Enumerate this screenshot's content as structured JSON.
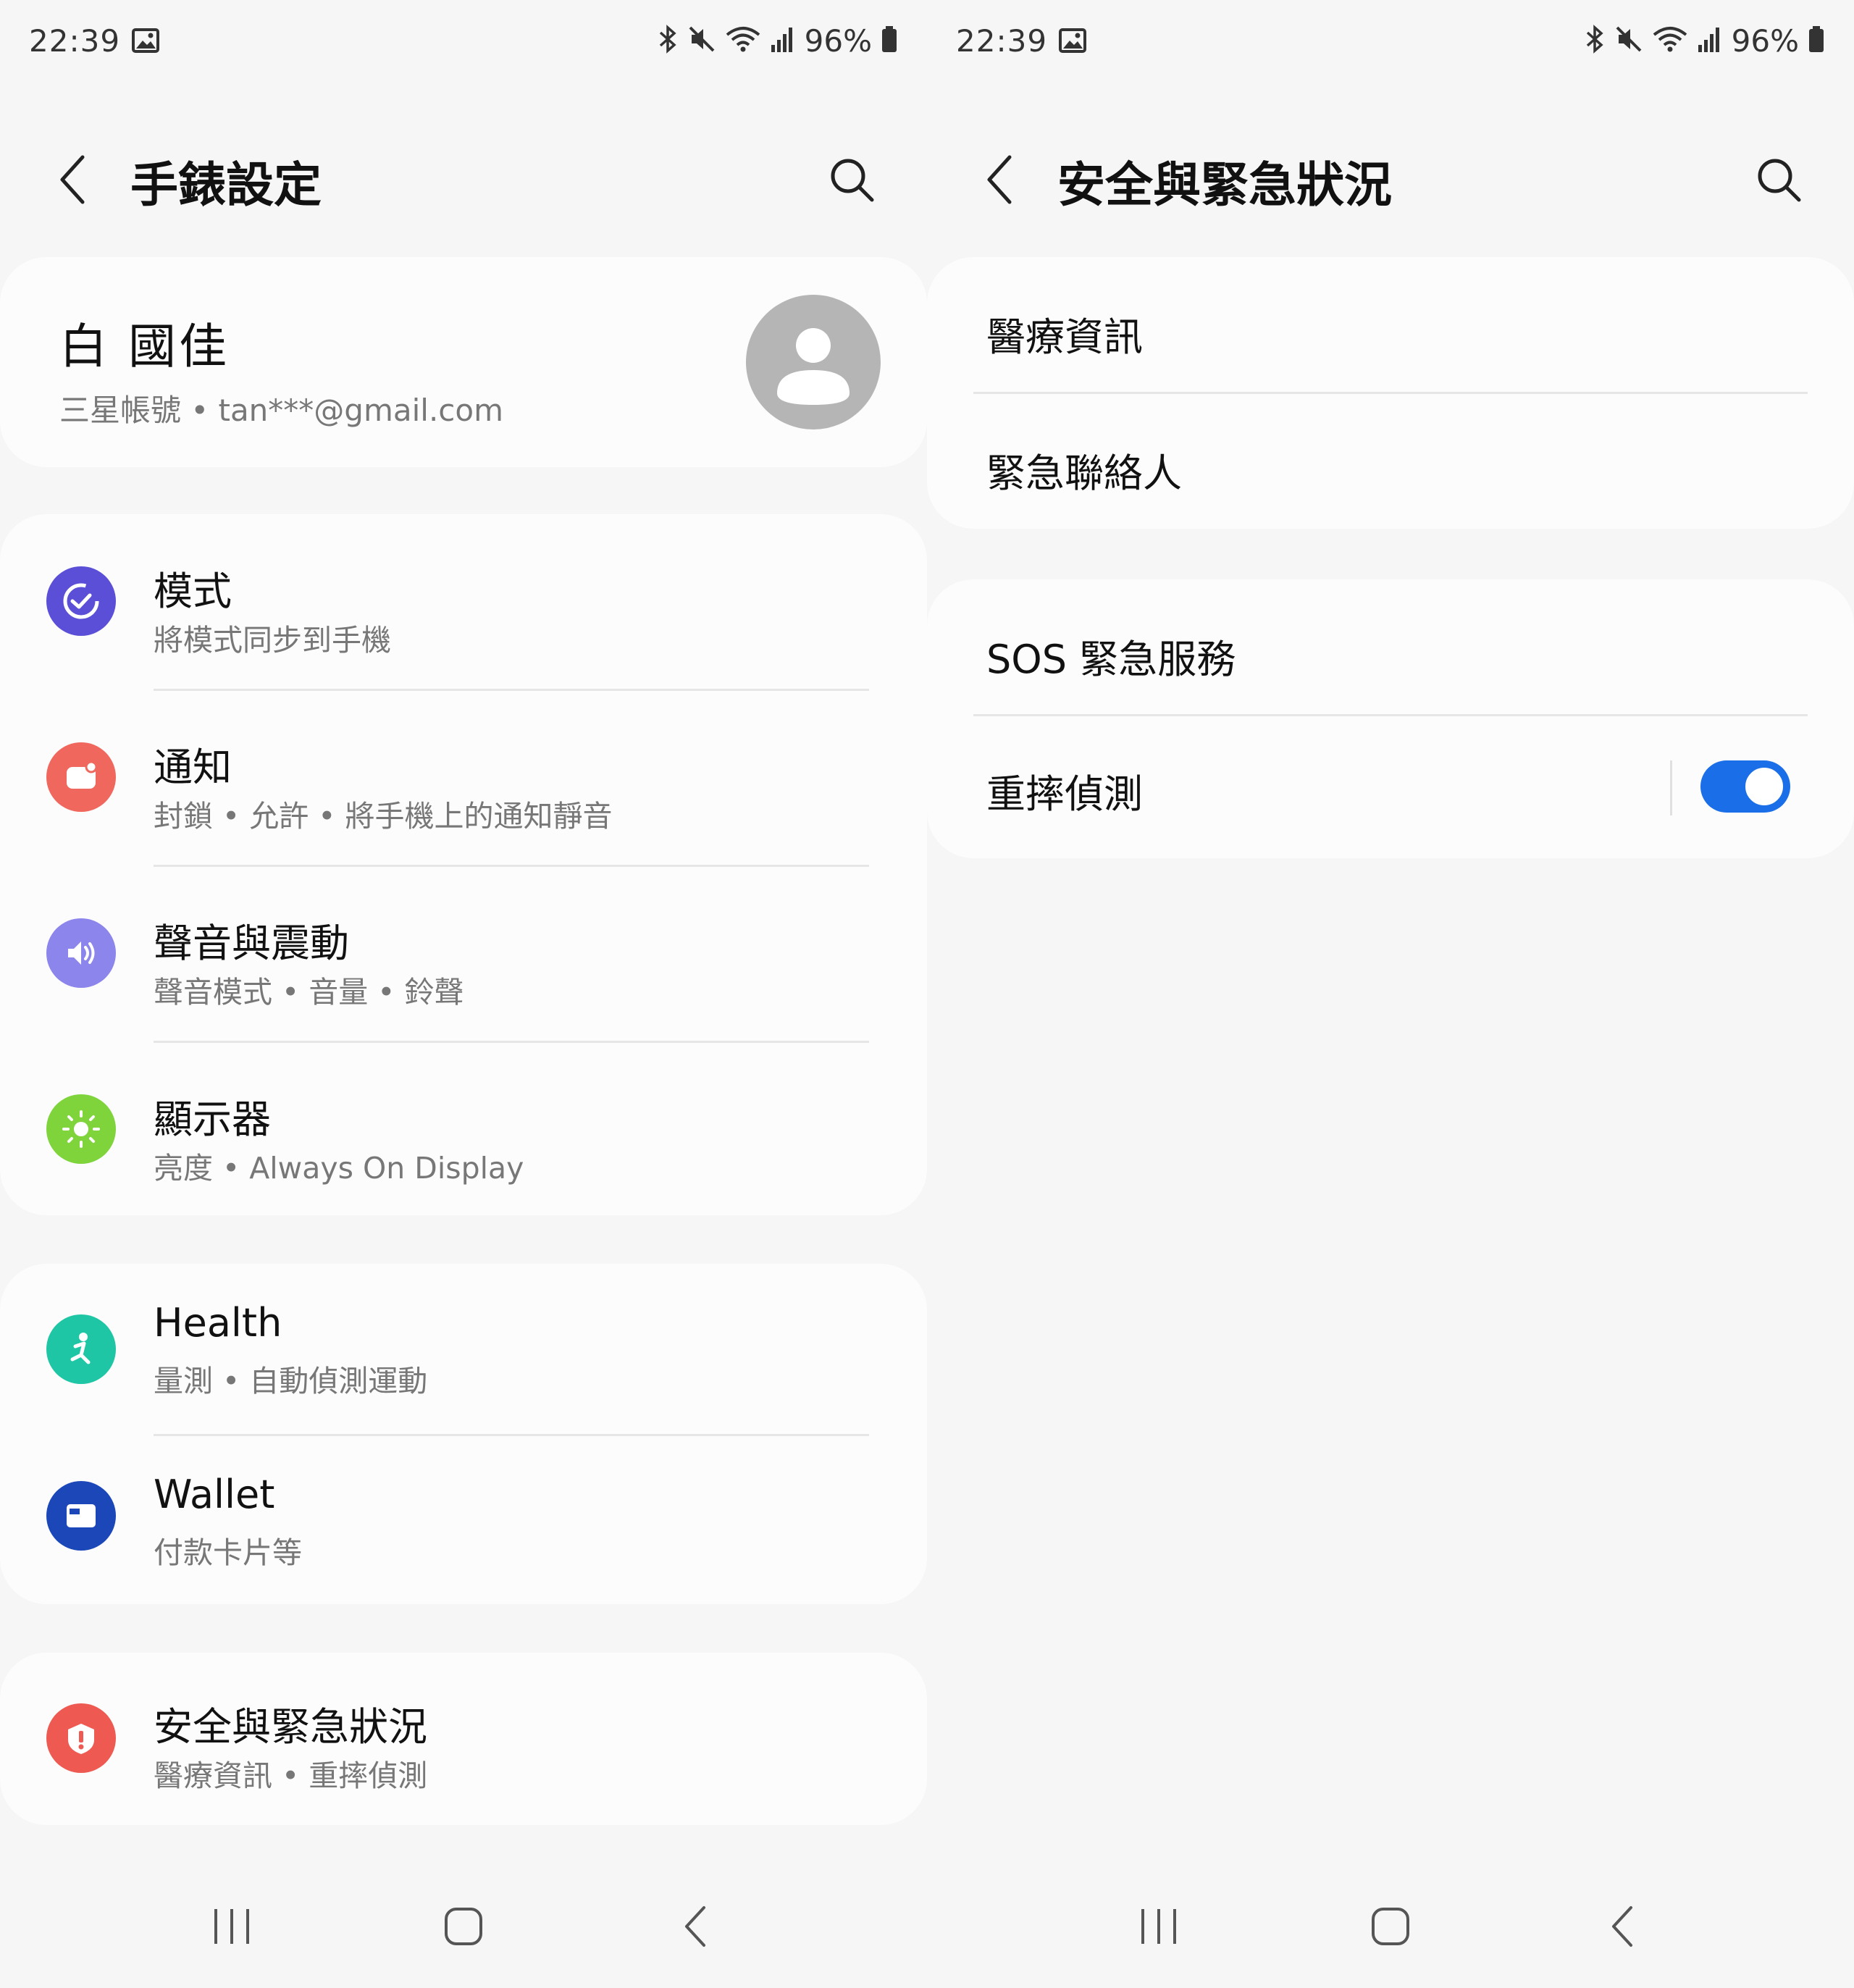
{
  "status_bar": {
    "time": "22:39",
    "battery": "96%",
    "icons": [
      "gallery-icon",
      "bluetooth-icon",
      "mute-icon",
      "wifi-icon",
      "signal-icon",
      "battery-icon"
    ]
  },
  "left": {
    "title": "手錶設定",
    "profile": {
      "name": "白 國佳",
      "subtitle": "三星帳號 • tan***@gmail.com"
    },
    "group1": [
      {
        "title": "模式",
        "subtitle": "將模式同步到手機",
        "icon": "modes-icon",
        "color": "#5a4fd6"
      },
      {
        "title": "通知",
        "subtitle": "封鎖 • 允許 • 將手機上的通知靜音",
        "icon": "notification-icon",
        "color": "#f0675d"
      },
      {
        "title": "聲音與震動",
        "subtitle": "聲音模式 • 音量 • 鈴聲",
        "icon": "sound-icon",
        "color": "#8c85ec"
      },
      {
        "title": "顯示器",
        "subtitle": "亮度 • Always On Display",
        "icon": "display-icon",
        "color": "#7fd43c"
      }
    ],
    "group2": [
      {
        "title": "Health",
        "subtitle": "量測 • 自動偵測運動",
        "icon": "health-icon",
        "color": "#1fc6a6"
      },
      {
        "title": "Wallet",
        "subtitle": "付款卡片等",
        "icon": "wallet-icon",
        "color": "#1b47b8"
      }
    ],
    "group3": [
      {
        "title": "安全與緊急狀況",
        "subtitle": "醫療資訊 • 重摔偵測",
        "icon": "safety-icon",
        "color": "#ee5a52"
      }
    ]
  },
  "right": {
    "title": "安全與緊急狀況",
    "group1": [
      {
        "title": "醫療資訊"
      },
      {
        "title": "緊急聯絡人"
      }
    ],
    "group2": [
      {
        "title": "SOS 緊急服務"
      },
      {
        "title": "重摔偵測",
        "toggle_on": true
      }
    ]
  },
  "nav": {
    "buttons": [
      "recents-button",
      "home-button",
      "back-button"
    ]
  }
}
